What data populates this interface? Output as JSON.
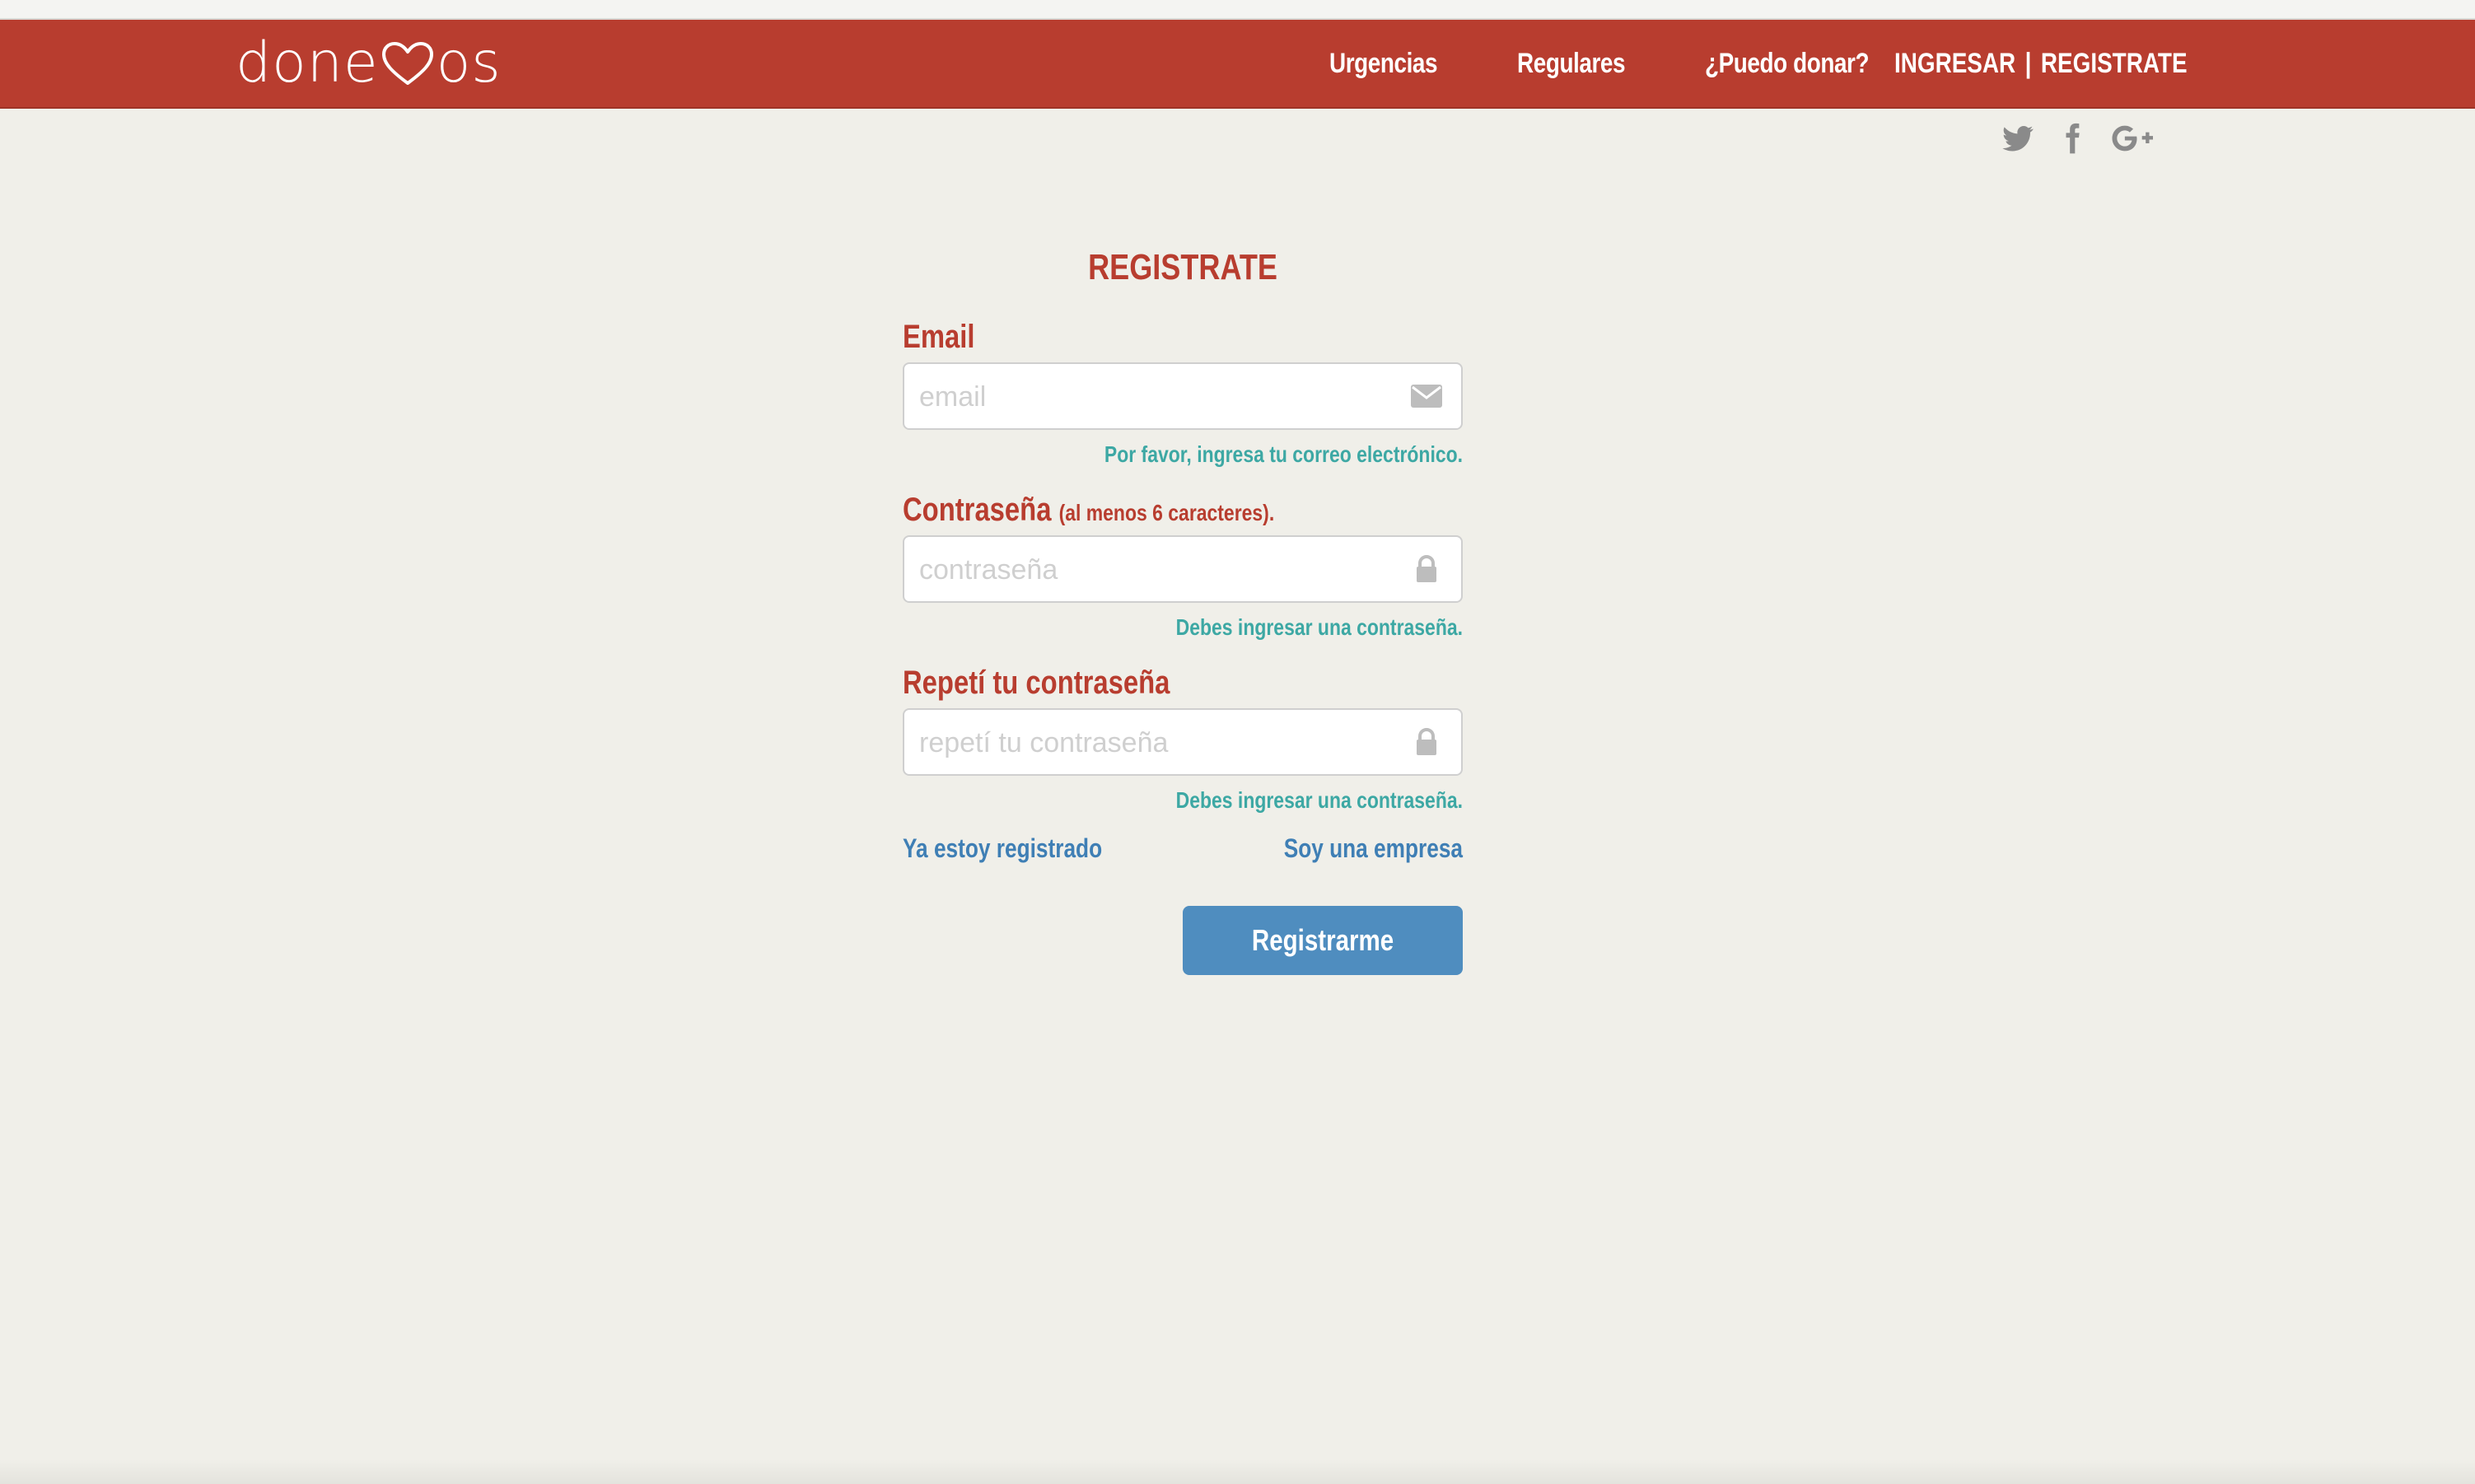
{
  "brand": {
    "logo_left": "done",
    "logo_right": "os",
    "heart_icon": "heart-icon"
  },
  "nav": {
    "items": [
      {
        "label": "Urgencias"
      },
      {
        "label": "Regulares"
      },
      {
        "label": "¿Puedo donar?"
      }
    ],
    "auth": {
      "login": "INGRESAR",
      "separator": "|",
      "register": "REGISTRATE"
    }
  },
  "social": {
    "icons": [
      "twitter-icon",
      "facebook-icon",
      "google-plus-icon"
    ]
  },
  "form": {
    "title": "REGISTRATE",
    "email": {
      "label": "Email",
      "placeholder": "email",
      "value": "",
      "hint": "Por favor, ingresa tu correo electrónico.",
      "icon": "envelope-icon"
    },
    "password": {
      "label": "Contraseña",
      "label_note": "(al menos 6 caracteres).",
      "placeholder": "contraseña",
      "value": "",
      "hint": "Debes ingresar una contraseña.",
      "icon": "lock-icon"
    },
    "password_repeat": {
      "label": "Repetí tu contraseña",
      "placeholder": "repetí tu contraseña",
      "value": "",
      "hint": "Debes ingresar una contraseña.",
      "icon": "lock-icon"
    },
    "already_registered": "Ya estoy registrado",
    "company": "Soy una empresa",
    "submit": "Registrarme"
  },
  "colors": {
    "brand_red": "#b83d2f",
    "hint_teal": "#3da8a4",
    "link_blue": "#3f7fb5",
    "button_blue": "#4f8dbf",
    "background": "#f0efe9"
  }
}
